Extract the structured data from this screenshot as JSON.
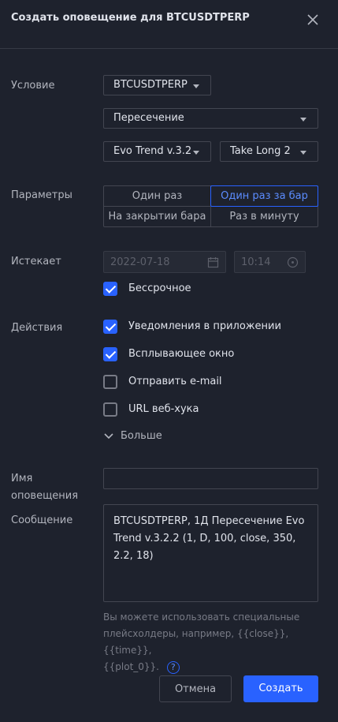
{
  "dialog": {
    "title": "Создать оповещение для BTCUSDTPERP"
  },
  "condition": {
    "label": "Условие",
    "symbol": "BTCUSDTPERP",
    "operator": "Пересечение",
    "indicator": "Evo Trend v.3.2...",
    "plot": "Take Long 2"
  },
  "params": {
    "label": "Параметры",
    "options": [
      "Один раз",
      "Один раз за бар",
      "На закрытии бара",
      "Раз в минуту"
    ],
    "selected": "Один раз за бар"
  },
  "expires": {
    "label": "Истекает",
    "date_placeholder": "2022-07-18",
    "time_placeholder": "10:14",
    "unlimited_label": "Бессрочное",
    "unlimited_checked": true
  },
  "actions": {
    "label": "Действия",
    "items": [
      {
        "label": "Уведомления в приложении",
        "checked": true
      },
      {
        "label": "Всплывающее окно",
        "checked": true
      },
      {
        "label": "Отправить e-mail",
        "checked": false
      },
      {
        "label": "URL веб-хука",
        "checked": false
      }
    ],
    "more_label": "Больше"
  },
  "name": {
    "label_line1": "Имя",
    "label_line2": "оповещения",
    "value": ""
  },
  "message": {
    "label": "Сообщение",
    "value": "BTCUSDTPERP, 1Д Пересечение Evo Trend v.3.2.2 (1, D, 100, close, 350, 2.2, 18)",
    "hint_line1": "Вы можете использовать специальные",
    "hint_line2": "плейсхолдеры, например, {{close}}, {{time}},",
    "hint_line3": "{{plot_0}}."
  },
  "footer": {
    "cancel_label": "Отмена",
    "create_label": "Создать"
  },
  "colors": {
    "background": "#1e222d",
    "accent": "#2962ff",
    "border": "#434651"
  }
}
